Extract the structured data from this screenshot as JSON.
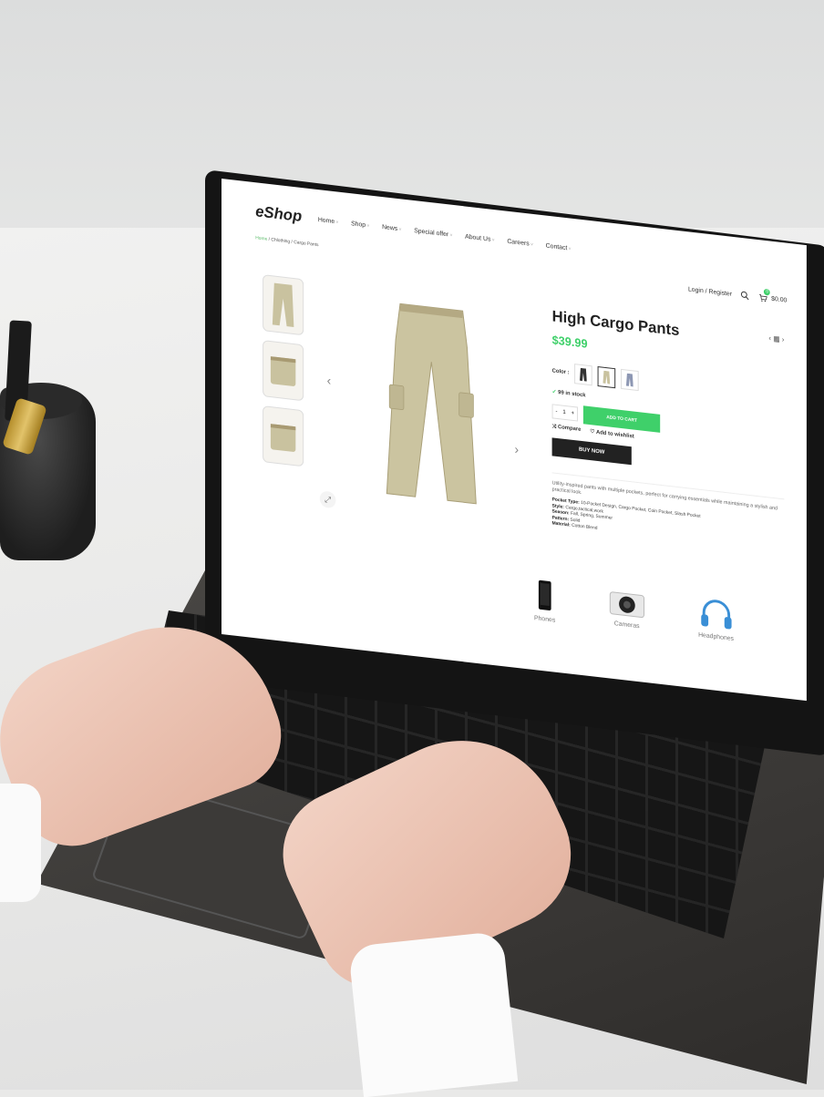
{
  "site": {
    "logo": "eShop",
    "nav": [
      "Home",
      "Shop",
      "News",
      "Special offer",
      "About Us",
      "Careers",
      "Contact"
    ],
    "breadcrumb": {
      "home": "Home",
      "sep1": " / ",
      "category": "Chlothing",
      "sep2": " / ",
      "current": "Cargo Pants"
    },
    "login_label": "Login / Register",
    "cart": {
      "count": "0",
      "total": "$0.00"
    }
  },
  "product": {
    "title": "High Cargo Pants",
    "price": "$39.99",
    "color_label": "Color :",
    "stock": "99 in stock",
    "quantity": "1",
    "qty_minus": "-",
    "qty_plus": "+",
    "add_to_cart": "ADD TO CART",
    "buy_now": "BUY NOW",
    "compare": "Compare",
    "wishlist": "Add to wishlist",
    "description": "Utility-inspired pants with multiple pockets, perfect for carrying essentials while maintaining a stylish and practical look.",
    "specs": [
      {
        "label": "Pocket Type:",
        "value": "10-Pocket Design, Cargo Pocket, Coin Pocket, Slash Pocket"
      },
      {
        "label": "Style:",
        "value": "Cargo,tactical,work"
      },
      {
        "label": "Season:",
        "value": "Fall, Spring, Summer"
      },
      {
        "label": "Pattern:",
        "value": "Solid"
      },
      {
        "label": "Material:",
        "value": "Cotton Blend"
      }
    ]
  },
  "categories": [
    {
      "label": "Phones",
      "icon": "phone-icon"
    },
    {
      "label": "Cameras",
      "icon": "camera-icon"
    },
    {
      "label": "Headphones",
      "icon": "headphones-icon"
    }
  ],
  "colors": {
    "accent": "#3fd06a",
    "dark": "#222222",
    "topbar": "#1d4a92"
  }
}
